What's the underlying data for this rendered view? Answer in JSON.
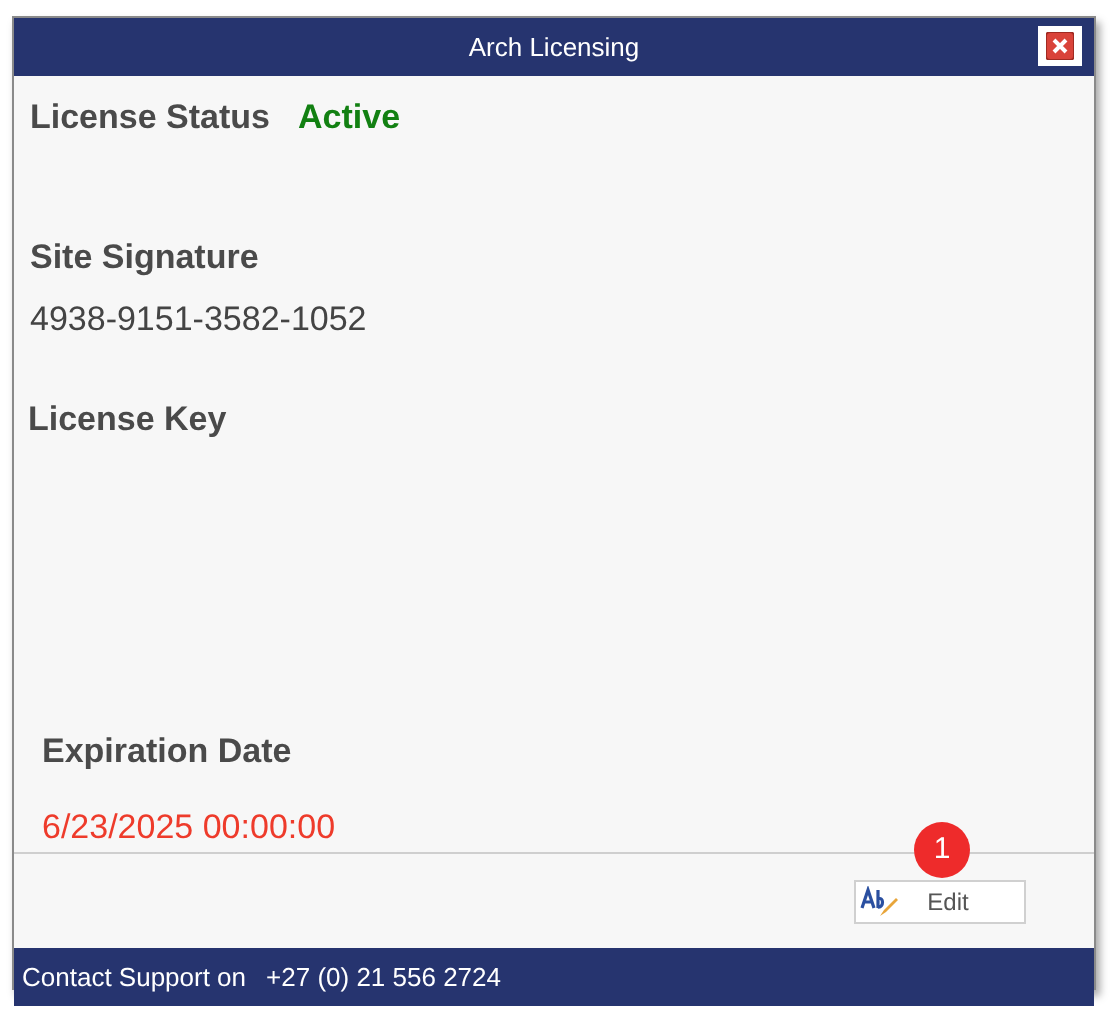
{
  "window": {
    "title": "Arch Licensing"
  },
  "license_status": {
    "label": "License Status",
    "value": "Active",
    "color": "#128012"
  },
  "site_signature": {
    "label": "Site Signature",
    "value": "4938-9151-3582-1052"
  },
  "license_key": {
    "label": "License Key"
  },
  "expiration": {
    "label": "Expiration Date",
    "value": "6/23/2025 00:00:00",
    "color": "#ee3b2b"
  },
  "edit_button": {
    "label": "Edit"
  },
  "callout": {
    "label": "1"
  },
  "status_bar": {
    "label": "Contact Support on",
    "phone": "+27 (0) 21 556 2724"
  }
}
